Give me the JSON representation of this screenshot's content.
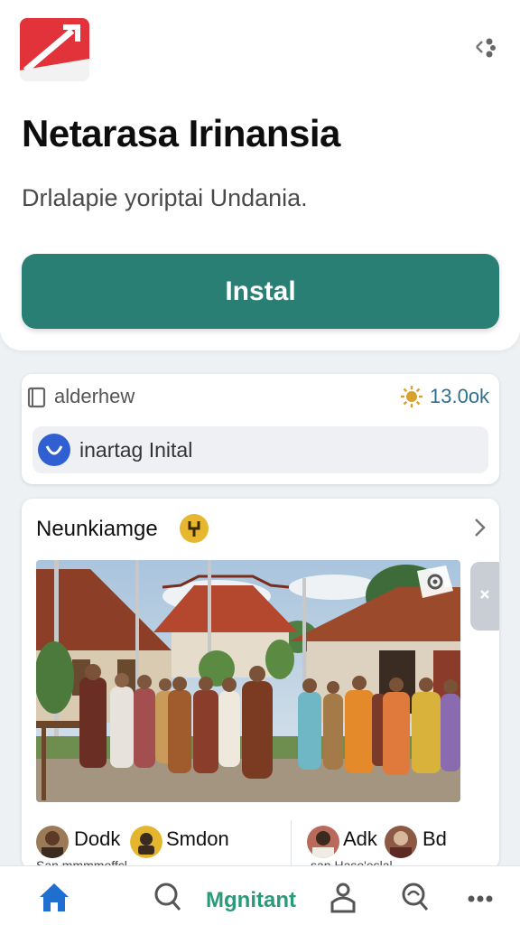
{
  "app": {
    "title": "Netarasa Irinansia",
    "subtitle": "Drlalapie yoriptai Undania.",
    "install_label": "Instal",
    "menu_icon": "share-dots-icon"
  },
  "info": {
    "label": "alderhew",
    "rating": "13.0ok",
    "chip_label": "inartag Inital"
  },
  "feed": {
    "title": "Neunkiamge",
    "people": [
      {
        "name": "Dodk",
        "avatar_icon": "avatar"
      },
      {
        "name": "Smdon",
        "avatar_icon": "avatar"
      },
      {
        "name": "Adk",
        "avatar_icon": "avatar"
      },
      {
        "name": "Bd",
        "avatar_icon": "avatar"
      }
    ],
    "captions": [
      "San mmmmoffcl",
      "san Haso'eslal"
    ]
  },
  "nav": {
    "center_label": "Mgnitant",
    "icons": [
      "home-icon",
      "search-icon",
      "profile-icon",
      "discover-icon",
      "more-icon"
    ]
  },
  "colors": {
    "accent": "#2a7f75",
    "nav_active": "#1f6fd1",
    "nav_label": "#2a9a7a",
    "rating_star": "#d9a12b"
  }
}
